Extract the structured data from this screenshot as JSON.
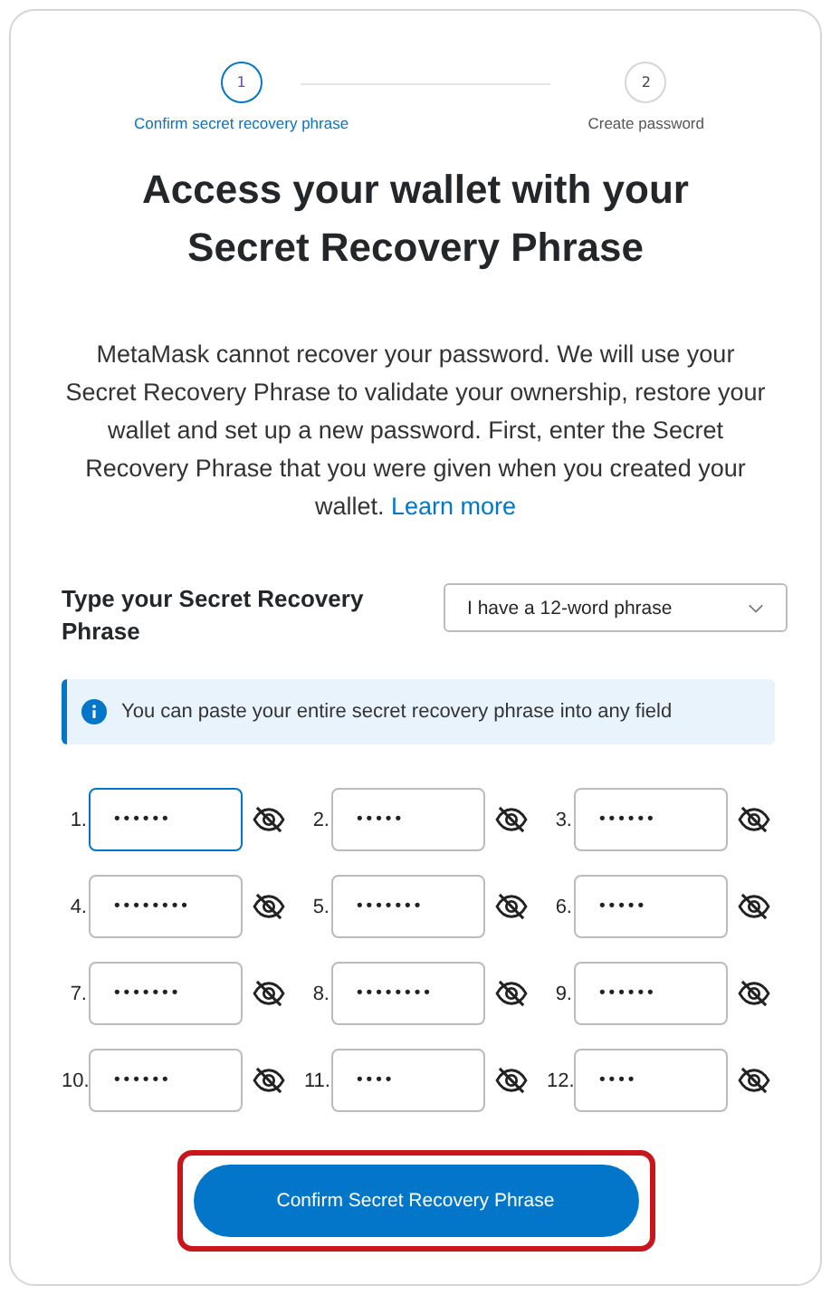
{
  "steps": [
    {
      "number": "1",
      "label": "Confirm secret recovery phrase",
      "selected": true
    },
    {
      "number": "2",
      "label": "Create password",
      "selected": false
    }
  ],
  "title": "Access your wallet with your Secret Recovery Phrase",
  "intro": "MetaMask cannot recover your password. We will use your Secret Recovery Phrase to validate your ownership, restore your wallet and set up a new password. First, enter the Secret Recovery Phrase that you were given when you created your wallet.",
  "learn_more": "Learn more",
  "phrase_type": {
    "label": "Type your Secret Recovery Phrase",
    "value": "I have a 12-word phrase"
  },
  "info": "You can paste your entire secret recovery phrase into any field",
  "words": [
    {
      "index": "1.",
      "value": "••••••",
      "focused": true
    },
    {
      "index": "2.",
      "value": "•••••",
      "focused": false
    },
    {
      "index": "3.",
      "value": "••••••",
      "focused": false
    },
    {
      "index": "4.",
      "value": "••••••••",
      "focused": false
    },
    {
      "index": "5.",
      "value": "•••••••",
      "focused": false
    },
    {
      "index": "6.",
      "value": "•••••",
      "focused": false
    },
    {
      "index": "7.",
      "value": "•••••••",
      "focused": false
    },
    {
      "index": "8.",
      "value": "••••••••",
      "focused": false
    },
    {
      "index": "9.",
      "value": "••••••",
      "focused": false
    },
    {
      "index": "10.",
      "value": "••••••",
      "focused": false
    },
    {
      "index": "11.",
      "value": "••••",
      "focused": false
    },
    {
      "index": "12.",
      "value": "••••",
      "focused": false
    }
  ],
  "confirm_button": {
    "label": "Confirm Secret Recovery Phrase",
    "highlighted": true
  }
}
